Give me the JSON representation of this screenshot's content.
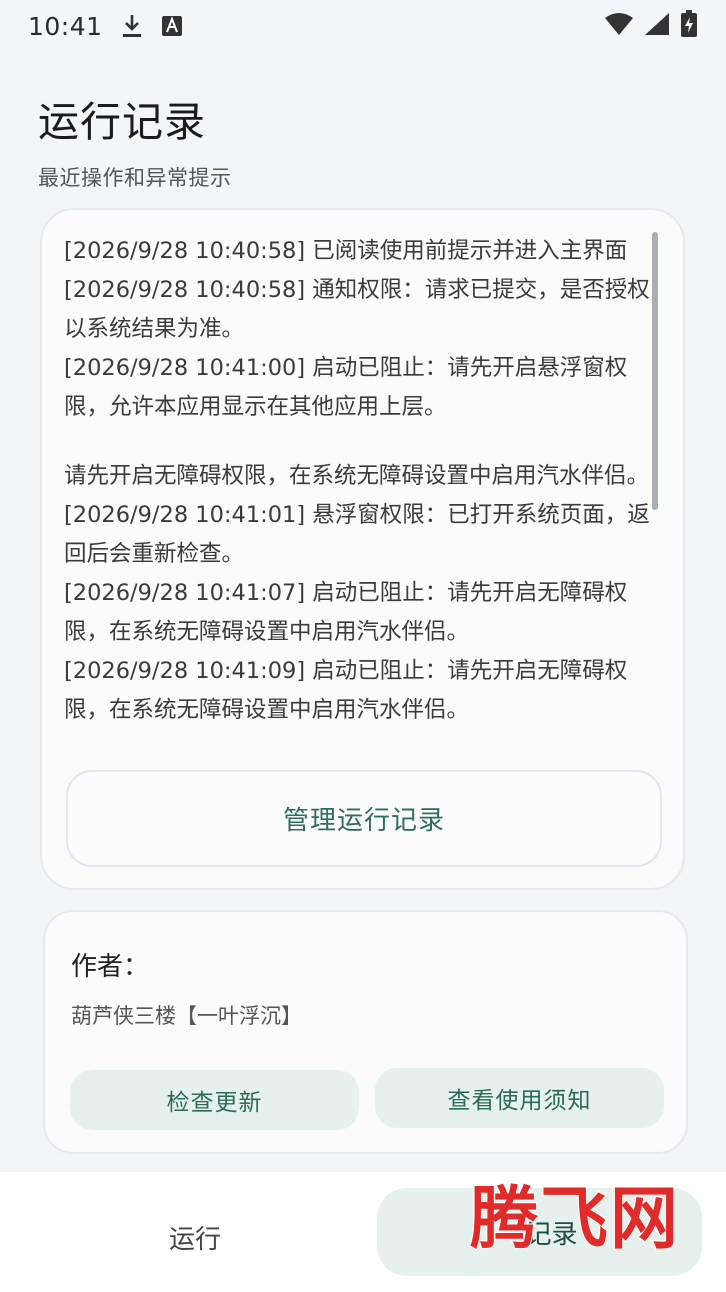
{
  "status_bar": {
    "time": "10:41",
    "icons": [
      "download-icon",
      "text-a-icon",
      "wifi-icon",
      "signal-icon",
      "battery-charging-icon"
    ]
  },
  "header": {
    "title": "运行记录",
    "subtitle": "最近操作和异常提示"
  },
  "log": {
    "lines": [
      "[2026/9/28 10:40:58] 已阅读使用前提示并进入主界面",
      "[2026/9/28 10:40:58] 通知权限：请求已提交，是否授权以系统结果为准。",
      "[2026/9/28 10:41:00] 启动已阻止：请先开启悬浮窗权限，允许本应用显示在其他应用上层。",
      "",
      "请先开启无障碍权限，在系统无障碍设置中启用汽水伴侣。",
      "[2026/9/28 10:41:01] 悬浮窗权限：已打开系统页面，返回后会重新检查。",
      "[2026/9/28 10:41:07] 启动已阻止：请先开启无障碍权限，在系统无障碍设置中启用汽水伴侣。",
      "[2026/9/28 10:41:09] 启动已阻止：请先开启无障碍权限，在系统无障碍设置中启用汽水伴侣。"
    ],
    "manage_label": "管理运行记录"
  },
  "author": {
    "label": "作者：",
    "name": "葫芦侠三楼【一叶浮沉】",
    "check_update_label": "检查更新",
    "notice_label": "查看使用须知"
  },
  "nav": {
    "run_label": "运行",
    "log_label": "记录"
  },
  "watermark": "腾飞网",
  "colors": {
    "accent": "#2e6e5c",
    "pill_bg": "#e6f1ee",
    "background": "#f3f5f9",
    "watermark": "#e02b2b"
  }
}
